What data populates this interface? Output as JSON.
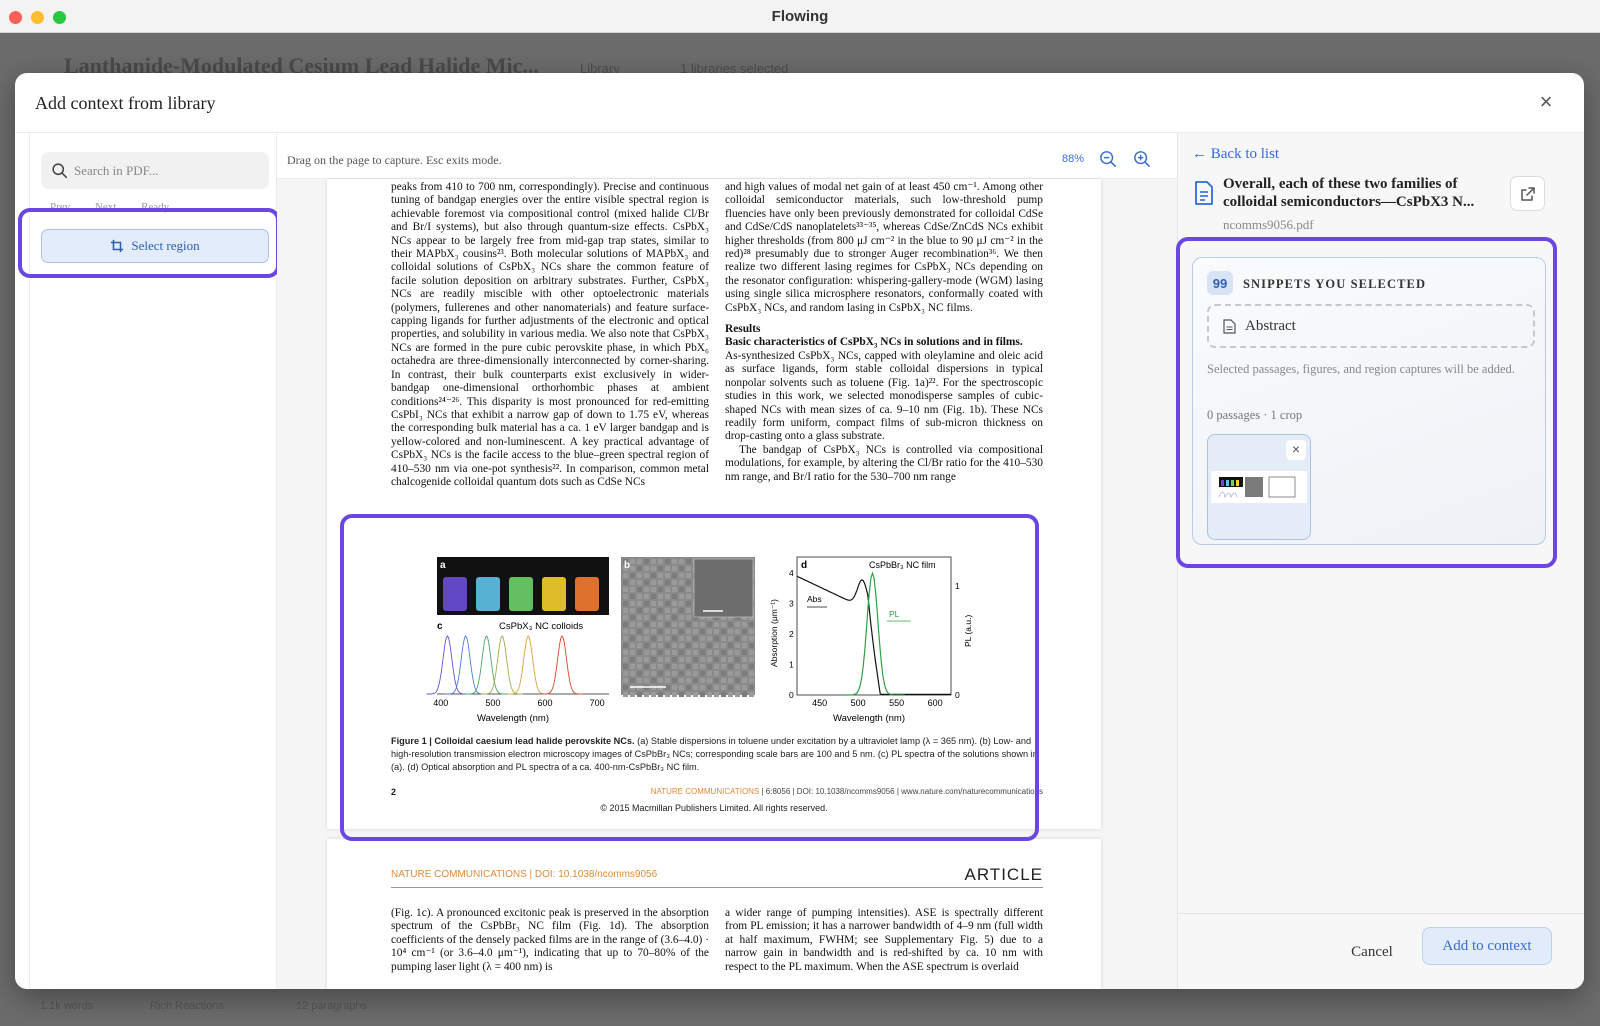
{
  "window": {
    "title": "Flowing"
  },
  "background_app": {
    "doc_title": "Lanthanide-Modulated Cesium Lead Halide Mic...",
    "tab_library": "Library",
    "tab_selected": "1 libraries selected",
    "footer_items": [
      "1.1k words",
      "Rich Reactions",
      "12 paragraphs"
    ]
  },
  "modal": {
    "title": "Add context from library",
    "close_label": "×"
  },
  "left_panel": {
    "search_placeholder": "Search in PDF...",
    "nav": {
      "prev": "Prev",
      "next": "Next",
      "ready": "Ready"
    },
    "select_region_label": "Select region"
  },
  "viewer": {
    "hint": "Drag on the page to capture. Esc exits mode.",
    "zoom_level": "88%",
    "page1": {
      "left_column": "peaks from 410 to 700 nm, correspondingly). Precise and continuous tuning of bandgap energies over the entire visible spectral region is achievable foremost via compositional control (mixed halide Cl/Br and Br/I systems), but also through quantum-size effects. CsPbX₃ NCs appear to be largely free from mid-gap trap states, similar to their MAPbX₃ cousins²³. Both molecular solutions of MAPbX₃ and colloidal solutions of CsPbX₃ NCs share the common feature of facile solution deposition on arbitrary substrates. Further, CsPbX₃ NCs are readily miscible with other optoelectronic materials (polymers, fullerenes and other nanomaterials) and feature surface-capping ligands for further adjustments of the electronic and optical properties, and solubility in various media. We also note that CsPbX₃ NCs are formed in the pure cubic perovskite phase, in which PbX₆ octahedra are three-dimensionally interconnected by corner-sharing. In contrast, their bulk counterparts exist exclusively in wider-bandgap one-dimensional orthorhombic phases at ambient conditions²⁴⁻²⁶. This disparity is most pronounced for red-emitting CsPbI₃ NCs that exhibit a narrow gap of down to 1.75 eV, whereas the corresponding bulk material has a ca. 1 eV larger bandgap and is yellow-colored and non-luminescent. A key practical advantage of CsPbX₃ NCs is the facile access to the blue–green spectral region of 410–530 nm via one-pot synthesis²². In comparison, common metal chalcogenide colloidal quantum dots such as CdSe NCs",
      "right_column_top": "and high values of modal net gain of at least 450 cm⁻¹. Among other colloidal semiconductor materials, such low-threshold pump fluencies have only been previously demonstrated for colloidal CdSe and CdSe/CdS nanoplatelets³³⁻³⁵, whereas CdSe/ZnCdS NCs exhibit higher thresholds (from 800 μJ cm⁻² in the blue to 90 μJ cm⁻² in the red)²⁸ presumably due to stronger Auger recombination³⁶. We then realize two different lasing regimes for CsPbX₃ NCs depending on the resonator configuration: whispering-gallery-mode (WGM) lasing using single silica microsphere resonators, conformally coated with CsPbX₃ NCs, and random lasing in CsPbX₃ NC films.",
      "results_heading": "Results",
      "results_subheading": "Basic characteristics of CsPbX₃ NCs in solutions and in films.",
      "results_p1": "As-synthesized CsPbX₃ NCs, capped with oleylamine and oleic acid as surface ligands, form stable colloidal dispersions in typical nonpolar solvents such as toluene (Fig. 1a)²². For the spectroscopic studies in this work, we selected monodisperse samples of cubic-shaped NCs with mean sizes of ca. 9–10 nm (Fig. 1b). These NCs readily form uniform, compact films of sub-micron thickness on drop-casting onto a glass substrate.",
      "results_p2": "The bandgap of CsPbX₃ NCs is controlled via compositional modulations, for example, by altering the Cl/Br ratio for the 410–530 nm range, and Br/I ratio for the 530–700 nm range",
      "figure": {
        "panel_a": "a",
        "panel_b": "b",
        "panel_c": "c",
        "panel_d": "d",
        "colloids_title": "CsPbX₃ NC colloids",
        "film_title": "CsPbBr₃ NC film",
        "c_xticks": [
          "400",
          "500",
          "600",
          "700"
        ],
        "c_xlabel": "Wavelength (nm)",
        "d_xticks": [
          "450",
          "500",
          "550",
          "600"
        ],
        "d_xlabel": "Wavelength (nm)",
        "d_ylabel_left": "Absorption (μm⁻¹)",
        "d_ylabel_right": "PL (a.u.)",
        "d_yticks_left": [
          "0",
          "1",
          "2",
          "3",
          "4"
        ],
        "d_yticks_right": [
          "0",
          "1"
        ],
        "abs_label": "Abs",
        "pl_label": "PL"
      },
      "caption_bold": "Figure 1 | Colloidal caesium lead halide perovskite NCs.",
      "caption_text": " (a) Stable dispersions in toluene under excitation by a ultraviolet lamp (λ = 365 nm). (b) Low- and high-resolution transmission electron microscopy images of CsPbBr₃ NCs; corresponding scale bars are 100 and 5 nm. (c) PL spectra of the solutions shown in (a). (d) Optical absorption and PL spectra of a ca. 400-nm-CsPbBr₃ NC film.",
      "page_number": "2",
      "footer_journal": "NATURE COMMUNICATIONS",
      "footer_rest": " | 6:8056 | DOI: 10.1038/ncomms9056 | www.nature.com/naturecommunications",
      "copyright": "© 2015 Macmillan Publishers Limited. All rights reserved."
    },
    "page2": {
      "journal": "NATURE COMMUNICATIONS | DOI: 10.1038/ncomms9056",
      "article_label": "ARTICLE",
      "left_column": "(Fig. 1c). A pronounced excitonic peak is preserved in the absorption spectrum of the CsPbBr₃ NC film (Fig. 1d). The absorption coefficients of the densely packed films are in the range of (3.6–4.0) · 10⁴ cm⁻¹ (or 3.6–4.0 μm⁻¹), indicating that up to 70–80% of the pumping laser light (λ = 400 nm) is",
      "right_column": "a wider range of pumping intensities). ASE is spectrally different from PL emission; it has a narrower bandwidth of 4–9 nm (full width at half maximum, FWHM; see Supplementary Fig. 5) due to a narrow gain in bandwidth and is red-shifted by ca. 10 nm with respect to the PL maximum. When the ASE spectrum is overlaid"
    }
  },
  "right_panel": {
    "back_label": "← Back to list",
    "doc_title": "Overall, each of these two families of colloidal semiconductors—CsPbX3 N...",
    "doc_file": "ncomms9056.pdf",
    "snippets": {
      "badge": "99",
      "title": "SNIPPETS YOU SELECTED",
      "abstract_label": "Abstract",
      "description": "Selected passages, figures, and region captures will be added.",
      "count": "0 passages · 1 crop",
      "remove_label": "×"
    },
    "cancel_label": "Cancel",
    "add_label": "Add to context"
  },
  "colors": {
    "accent": "#2f6bd6",
    "highlight": "#6a46e3",
    "journal_orange": "#e08a3a",
    "abs_curve": "#111111",
    "pl_curve": "#2ea043",
    "vial_colors": [
      "#6c4ed8",
      "#5fc3e8",
      "#6ed36a",
      "#f4d22e",
      "#f47b30"
    ],
    "spectra_colors": [
      "#6a4fd0",
      "#4a7fdc",
      "#4aa86a",
      "#9ab04a",
      "#e0a040",
      "#d04a2a"
    ]
  }
}
